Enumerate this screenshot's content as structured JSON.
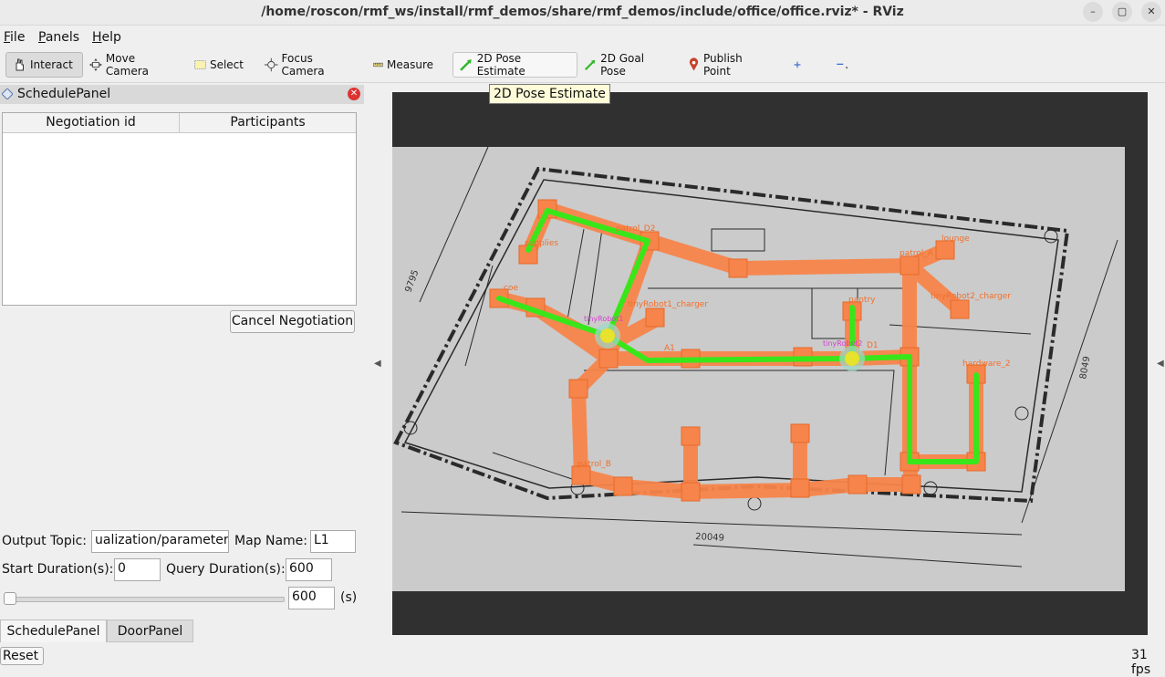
{
  "window": {
    "title": "/home/roscon/rmf_ws/install/rmf_demos/share/rmf_demos/include/office/office.rviz* - RViz",
    "minimize_label": "–",
    "maximize_label": "▢",
    "close_label": "✕"
  },
  "menu": [
    {
      "first": "F",
      "rest": "ile"
    },
    {
      "first": "P",
      "rest": "anels"
    },
    {
      "first": "H",
      "rest": "elp"
    }
  ],
  "toolbar": {
    "interact": "Interact",
    "move_camera": "Move Camera",
    "select": "Select",
    "focus_camera": "Focus Camera",
    "measure": "Measure",
    "pose_estimate": "2D Pose Estimate",
    "goal_pose": "2D Goal Pose",
    "publish_point": "Publish Point",
    "add_icon": "plus-icon",
    "remove_icon": "minus-icon"
  },
  "tooltip": "2D Pose Estimate",
  "schedule_panel": {
    "title": "SchedulePanel",
    "columns": [
      "Negotiation id",
      "Participants"
    ],
    "cancel_negotiation": "Cancel Negotiation",
    "output_topic_label": "Output Topic:",
    "output_topic_value": "ualization/parameters",
    "map_name_label": "Map Name:",
    "map_name_value": "L1",
    "start_duration_label": "Start Duration(s):",
    "start_duration_value": "0",
    "query_duration_label": "Query Duration(s):",
    "query_duration_value": "600",
    "slider_value": "600",
    "slider_unit": "(s)",
    "tabs": [
      "SchedulePanel",
      "DoorPanel"
    ],
    "reset": "Reset"
  },
  "map": {
    "labels": {
      "pantry": "pantry",
      "patrol_d2": "patrol_D2",
      "coe": "coe",
      "charger1": "tinyRobot1_charger",
      "robot1": "tinyRobot1",
      "robot2": "tinyRobot2",
      "d1": "D1",
      "a1": "A1",
      "hardware2": "hardware_2",
      "charger2": "tinyRobot2_charger",
      "patrol_b": "patrol_B",
      "lounge": "lounge",
      "supplies": "supplies",
      "patrol_a": "patrol_A",
      "dim_h": "9795",
      "dim_v": "8049",
      "dim_bottom": "20049"
    },
    "colors": {
      "lane": "#f7844a",
      "path": "#39e61a",
      "robot_label": "#d43fd1"
    }
  },
  "status": {
    "fps": "31 fps"
  }
}
